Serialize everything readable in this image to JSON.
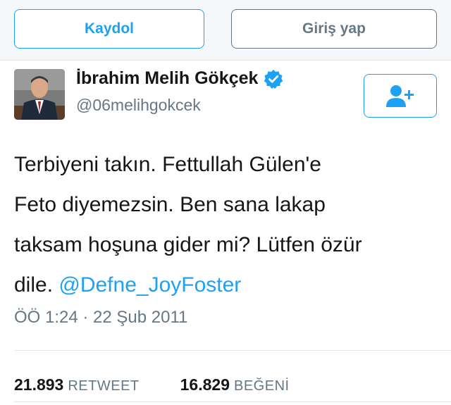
{
  "auth": {
    "signup_label": "Kaydol",
    "login_label": "Giriş yap"
  },
  "profile": {
    "name": "İbrahim Melih Gökçek",
    "handle": "@06melihgokcek",
    "verified_icon": "verified-badge-icon",
    "follow_icon": "add-user-icon"
  },
  "tweet": {
    "lines": [
      "Terbiyeni takın. Fettullah Gülen'e",
      "Feto diyemezsin. Ben sana lakap",
      "taksam hoşuna gider mi? Lütfen özür"
    ],
    "last_line_prefix": "dile. ",
    "mention": "@Defne_JoyFoster",
    "timestamp": "ÖÖ 1:24 · 22 Şub 2011"
  },
  "stats": {
    "retweets_count": "21.893",
    "retweets_label": "RETWEET",
    "likes_count": "16.829",
    "likes_label": "BEĞENİ"
  },
  "colors": {
    "accent": "#1da1f2",
    "muted": "#657786",
    "text": "#14171a"
  }
}
